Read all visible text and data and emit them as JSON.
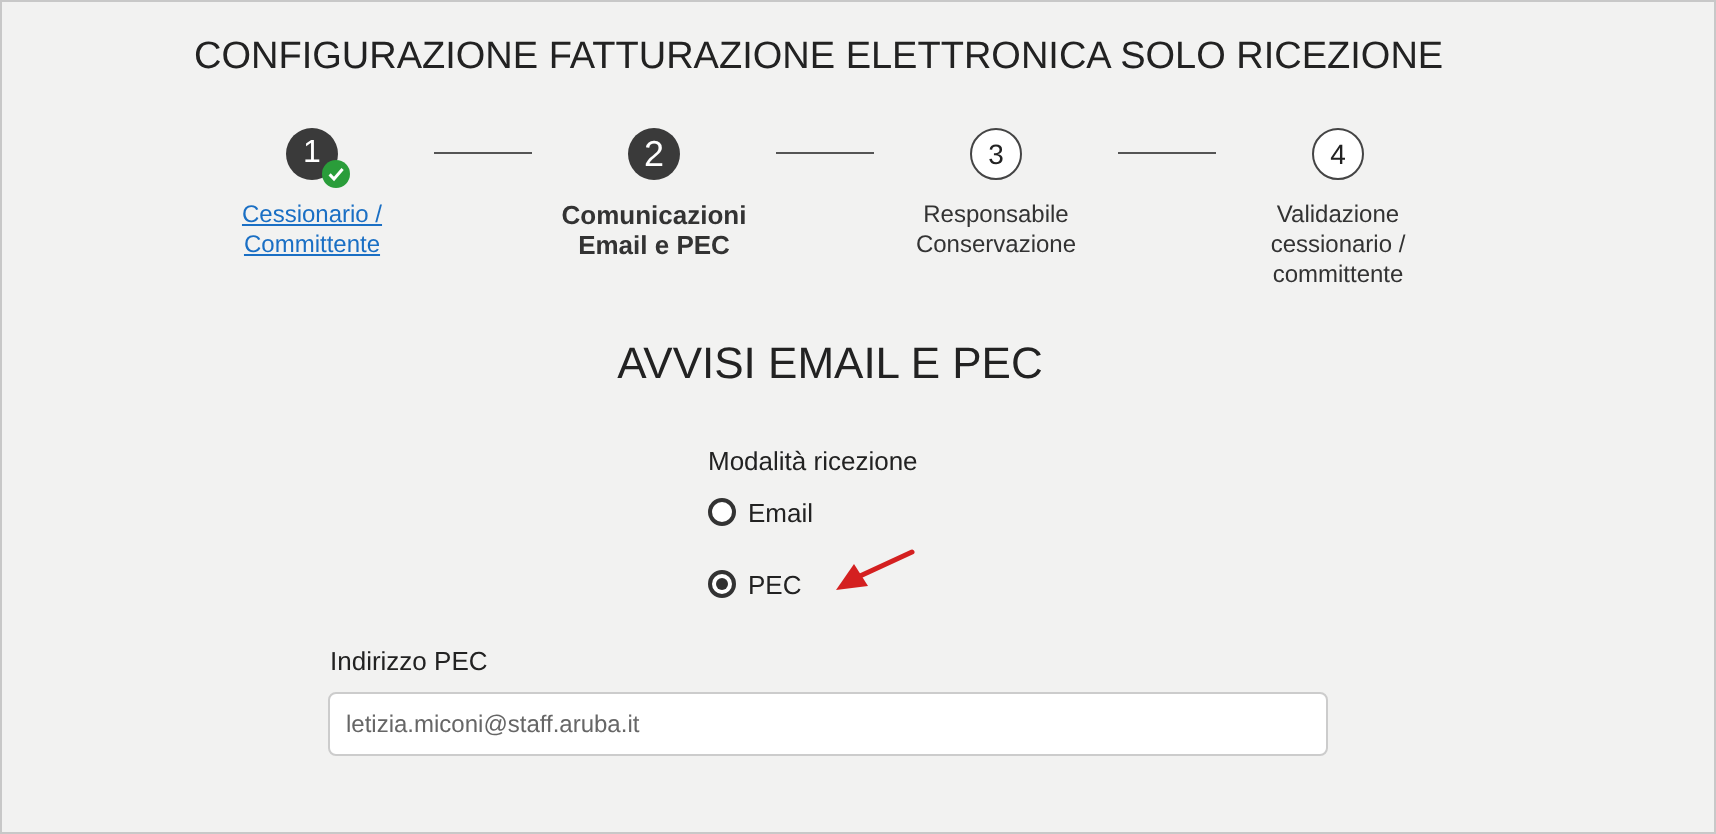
{
  "title": "CONFIGURAZIONE FATTURAZIONE ELETTRONICA SOLO RICEZIONE",
  "steps": [
    {
      "number": "1",
      "label": "Cessionario / Committente",
      "completed": true,
      "selected": false
    },
    {
      "number": "2",
      "label": "Comunicazioni Email e PEC",
      "completed": false,
      "selected": true
    },
    {
      "number": "3",
      "label": "Responsabile Conservazione",
      "completed": false,
      "selected": false
    },
    {
      "number": "4",
      "label": "Validazione cessionario / committente",
      "completed": false,
      "selected": false
    }
  ],
  "section_title": "AVVISI EMAIL E PEC",
  "reception_mode": {
    "label": "Modalità ricezione",
    "options": [
      {
        "label": "Email",
        "selected": false
      },
      {
        "label": "PEC",
        "selected": true,
        "annotated": true
      }
    ]
  },
  "pec_address": {
    "label": "Indirizzo PEC",
    "value": "letizia.miconi@staff.aruba.it"
  }
}
